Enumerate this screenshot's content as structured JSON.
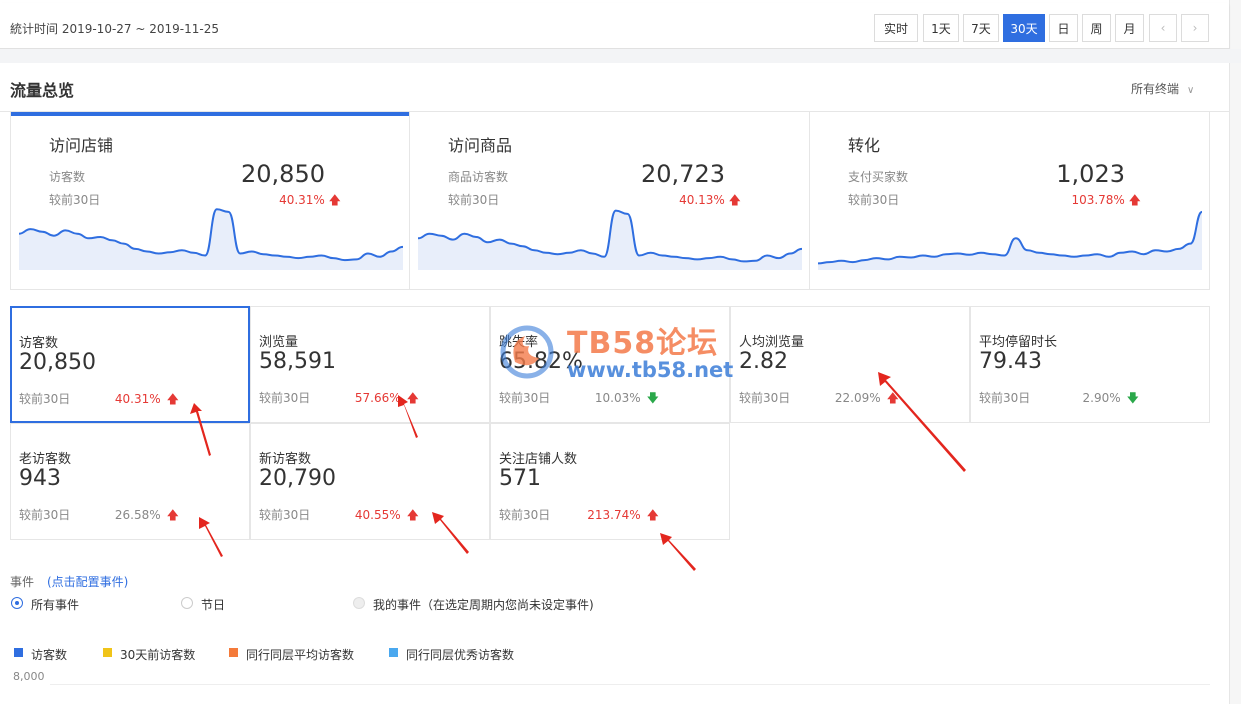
{
  "header": {
    "range_label": "統计时间 2019-10-27 ~ 2019-11-25",
    "periods": [
      "实时",
      "1天",
      "7天",
      "30天",
      "日",
      "周",
      "月"
    ],
    "active_period": "30天",
    "prev_icon": "chevron-left-icon",
    "next_icon": "chevron-right-icon"
  },
  "section": {
    "title": "流量总览",
    "terminal": "所有终端"
  },
  "summary_cards": [
    {
      "title": "访问店铺",
      "label": "访客数",
      "compare": "较前30日",
      "value": "20,850",
      "change": "40.31%",
      "trend": "up",
      "spark": [
        0.55,
        0.62,
        0.58,
        0.52,
        0.6,
        0.55,
        0.48,
        0.5,
        0.45,
        0.4,
        0.32,
        0.28,
        0.25,
        0.27,
        0.3,
        0.26,
        0.22,
        0.92,
        0.88,
        0.25,
        0.28,
        0.24,
        0.22,
        0.2,
        0.18,
        0.2,
        0.22,
        0.18,
        0.15,
        0.16,
        0.25,
        0.2,
        0.28,
        0.35
      ]
    },
    {
      "title": "访问商品",
      "label": "商品访客数",
      "compare": "较前30日",
      "value": "20,723",
      "change": "40.13%",
      "trend": "up",
      "spark": [
        0.48,
        0.55,
        0.52,
        0.46,
        0.55,
        0.5,
        0.42,
        0.46,
        0.4,
        0.36,
        0.3,
        0.26,
        0.24,
        0.26,
        0.3,
        0.25,
        0.2,
        0.9,
        0.85,
        0.22,
        0.26,
        0.22,
        0.2,
        0.18,
        0.16,
        0.18,
        0.2,
        0.16,
        0.13,
        0.14,
        0.22,
        0.18,
        0.25,
        0.32
      ]
    },
    {
      "title": "转化",
      "label": "支付买家数",
      "compare": "较前30日",
      "value": "1,023",
      "change": "103.78%",
      "trend": "up",
      "spark": [
        0.1,
        0.12,
        0.14,
        0.12,
        0.15,
        0.18,
        0.16,
        0.2,
        0.19,
        0.22,
        0.2,
        0.24,
        0.25,
        0.23,
        0.26,
        0.24,
        0.22,
        0.48,
        0.3,
        0.26,
        0.24,
        0.22,
        0.2,
        0.22,
        0.24,
        0.2,
        0.26,
        0.28,
        0.24,
        0.3,
        0.28,
        0.32,
        0.4,
        0.88
      ]
    }
  ],
  "metrics": [
    {
      "name": "访客数",
      "value": "20,850",
      "compare": "较前30日",
      "change": "40.31%",
      "trend": "up"
    },
    {
      "name": "浏览量",
      "value": "58,591",
      "compare": "较前30日",
      "change": "57.66%",
      "trend": "up"
    },
    {
      "name": "跳失率",
      "value": "65.82%",
      "compare": "较前30日",
      "change": "10.03%",
      "trend": "down"
    },
    {
      "name": "人均浏览量",
      "value": "2.82",
      "compare": "较前30日",
      "change": "22.09%",
      "trend": "up-neutral"
    },
    {
      "name": "平均停留时长",
      "value": "79.43",
      "compare": "较前30日",
      "change": "2.90%",
      "trend": "down"
    },
    {
      "name": "老访客数",
      "value": "943",
      "compare": "较前30日",
      "change": "26.58%",
      "trend": "up-neutral"
    },
    {
      "name": "新访客数",
      "value": "20,790",
      "compare": "较前30日",
      "change": "40.55%",
      "trend": "up"
    },
    {
      "name": "关注店铺人数",
      "value": "571",
      "compare": "较前30日",
      "change": "213.74%",
      "trend": "up"
    }
  ],
  "events": {
    "label": "事件",
    "config_link": "(点击配置事件)",
    "options": [
      "所有事件",
      "节日",
      "我的事件（在选定周期内您尚未设定事件)"
    ]
  },
  "legend": [
    {
      "name": "访客数",
      "color": "#2f6ee0"
    },
    {
      "name": "30天前访客数",
      "color": "#f0c419"
    },
    {
      "name": "同行同层平均访客数",
      "color": "#f47a3a"
    },
    {
      "name": "同行同层优秀访客数",
      "color": "#4aa8ef"
    }
  ],
  "y_axis_top": "8,000",
  "watermark": {
    "brand": "TB58论坛",
    "url": "www.tb58.net"
  },
  "colors": {
    "accent": "#2f6ee0",
    "up": "#e53935",
    "down": "#2aa84a",
    "annotation": "#e3261e"
  }
}
